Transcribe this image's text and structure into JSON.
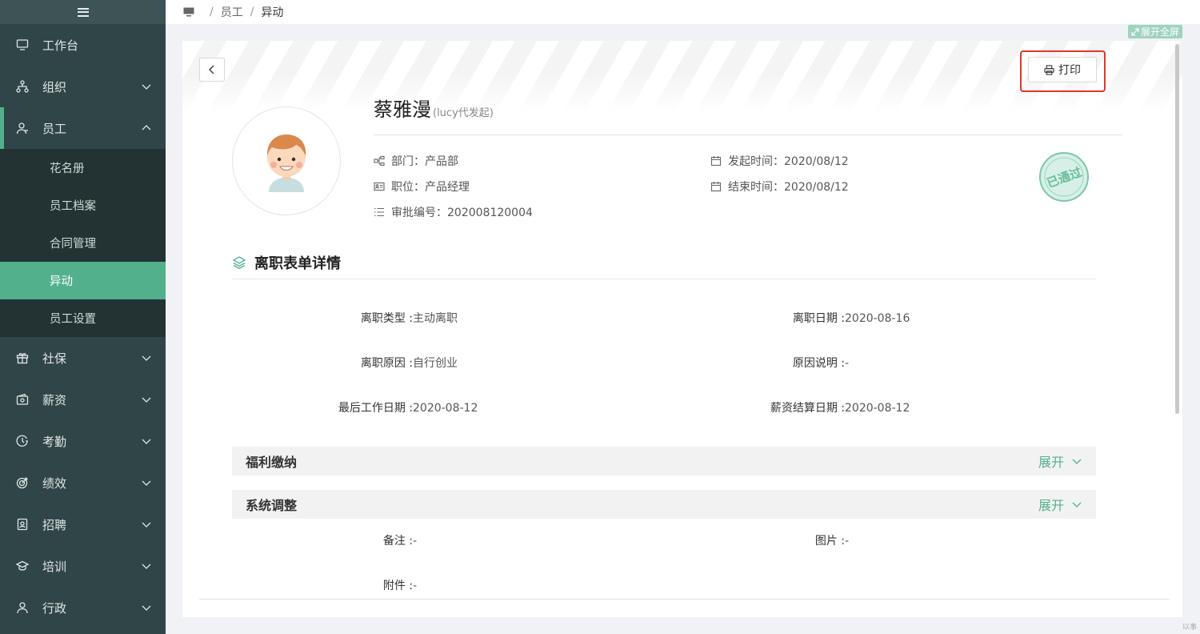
{
  "sidebar": {
    "items": [
      {
        "label": "工作台"
      },
      {
        "label": "组织"
      },
      {
        "label": "员工"
      },
      {
        "label": "社保"
      },
      {
        "label": "薪资"
      },
      {
        "label": "考勤"
      },
      {
        "label": "绩效"
      },
      {
        "label": "招聘"
      },
      {
        "label": "培训"
      },
      {
        "label": "行政"
      }
    ],
    "subitems": [
      {
        "label": "花名册"
      },
      {
        "label": "员工档案"
      },
      {
        "label": "合同管理"
      },
      {
        "label": "异动"
      },
      {
        "label": "员工设置"
      }
    ]
  },
  "breadcrumb": {
    "level1": "员工",
    "level2": "异动",
    "separator": "/"
  },
  "expand_fullscreen": "展开全屏",
  "toolbar": {
    "print_label": "打印"
  },
  "profile": {
    "name": "蔡雅漫",
    "initiator": "(lucy代发起)",
    "department": "部门：产品部",
    "position": "职位：产品经理",
    "approval_no": "审批编号：202008120004",
    "start_time": "发起时间：2020/08/12",
    "end_time": "结束时间：2020/08/12",
    "status_stamp": "已通过"
  },
  "section": {
    "title": "离职表单详情"
  },
  "fields": {
    "leave_type_label": "离职类型 : ",
    "leave_type_value": "主动离职",
    "leave_date_label": "离职日期 : ",
    "leave_date_value": "2020-08-16",
    "leave_reason_label": "离职原因 : ",
    "leave_reason_value": "自行创业",
    "reason_note_label": "原因说明 : ",
    "reason_note_value": "-",
    "last_work_label": "最后工作日期 : ",
    "last_work_value": "2020-08-12",
    "salary_settle_label": "薪资结算日期 : ",
    "salary_settle_value": "2020-08-12",
    "remark_label": "备注 : ",
    "remark_value": "-",
    "image_label": "图片 : ",
    "image_value": "-",
    "attachment_label": "附件 : ",
    "attachment_value": "-"
  },
  "panels": [
    {
      "title": "福利缴纳",
      "toggle": "展开"
    },
    {
      "title": "系统调整",
      "toggle": "展开"
    }
  ],
  "corner_text": "以事",
  "colors": {
    "sidebar_bg": "#304547",
    "accent": "#52b08d",
    "highlight": "#e0362f"
  }
}
